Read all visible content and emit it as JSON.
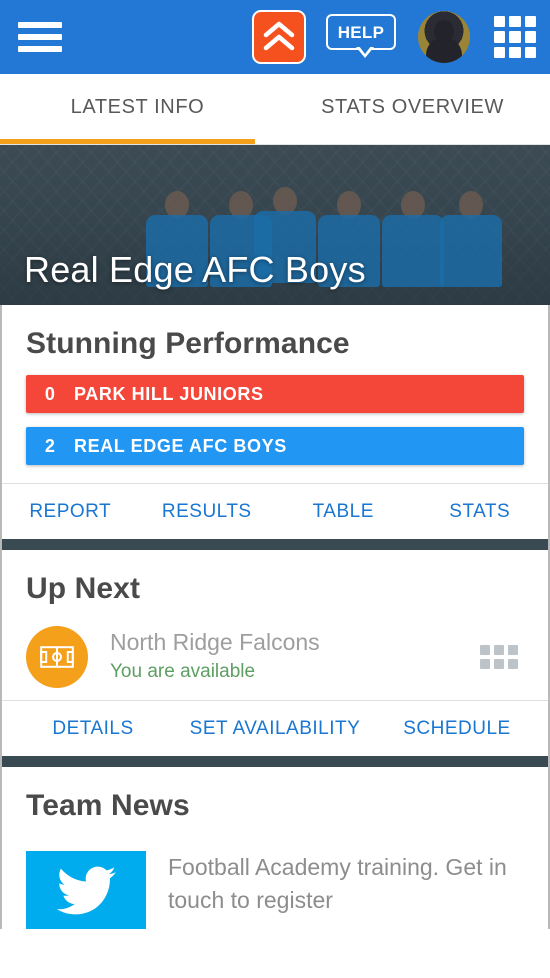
{
  "header": {
    "menu_label": "menu",
    "boost_label": "boost",
    "help_label": "HELP",
    "avatar_label": "profile",
    "apps_label": "apps",
    "background_color": "#2278d4",
    "boost_color": "#f4511e"
  },
  "tabs": {
    "active_index": 0,
    "accent_color": "#f5a01b",
    "items": [
      {
        "label": "LATEST INFO"
      },
      {
        "label": "STATS OVERVIEW"
      }
    ]
  },
  "hero": {
    "title": "Real Edge AFC Boys",
    "image_alt": "team photo"
  },
  "performance": {
    "title": "Stunning Performance",
    "scores": [
      {
        "score": "0",
        "team": "PARK HILL JUNIORS",
        "color": "#f4473a"
      },
      {
        "score": "2",
        "team": "REAL EDGE AFC BOYS",
        "color": "#2196f3"
      }
    ],
    "actions": [
      {
        "label": "REPORT"
      },
      {
        "label": "RESULTS"
      },
      {
        "label": "TABLE"
      },
      {
        "label": "STATS"
      }
    ]
  },
  "up_next": {
    "title": "Up Next",
    "fixture": {
      "opponent": "North Ridge Falcons",
      "availability": "You are available",
      "availability_color": "#5d9e62",
      "icon_color": "#f5a01b"
    },
    "actions": [
      {
        "label": "DETAILS"
      },
      {
        "label": "SET AVAILABILITY"
      },
      {
        "label": "SCHEDULE"
      }
    ]
  },
  "team_news": {
    "title": "Team News",
    "items": [
      {
        "source": "twitter",
        "text": "Football Academy training. Get in touch to register",
        "tile_color": "#00aced"
      }
    ]
  },
  "link_color": "#1976d2"
}
